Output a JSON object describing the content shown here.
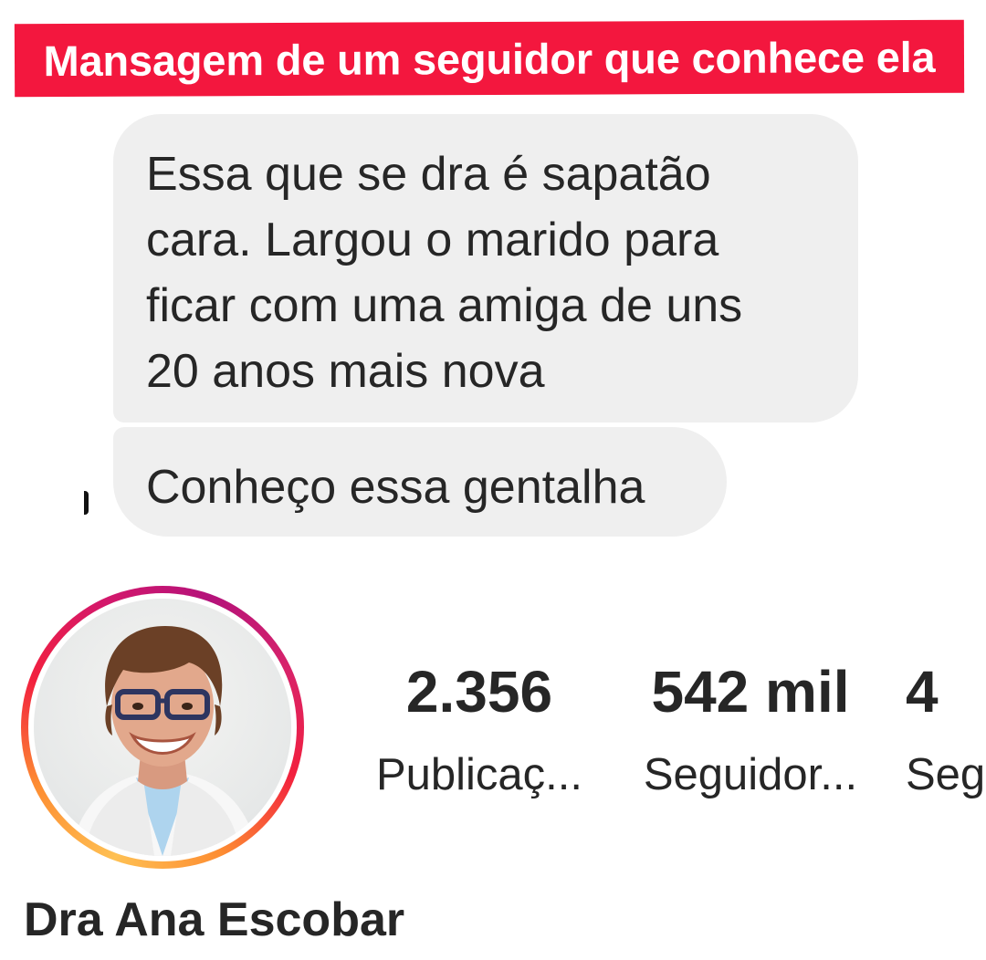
{
  "banner": {
    "text": "Mansagem de um seguidor que conhece ela",
    "color": "#f3173e"
  },
  "messages": [
    {
      "lines": [
        "Essa que se dra é sapatão",
        "cara. Largou o marido para",
        "ficar com uma amiga de uns",
        "20 anos mais nova"
      ]
    },
    {
      "lines": [
        "Conheço essa gentalha"
      ]
    }
  ],
  "profile": {
    "name": "Dra Ana Escobar",
    "avatar": "profile-photo",
    "stats": [
      {
        "value": "2.356",
        "label": "Publicaç..."
      },
      {
        "value": "542 mil",
        "label": "Seguidor..."
      },
      {
        "value": "4",
        "label": "Seg"
      }
    ]
  },
  "colors": {
    "bubble": "#efefef",
    "text": "#262626",
    "story_ring": [
      "#fec053",
      "#fd8d32",
      "#f2203e",
      "#d4186b",
      "#b4127a"
    ]
  }
}
